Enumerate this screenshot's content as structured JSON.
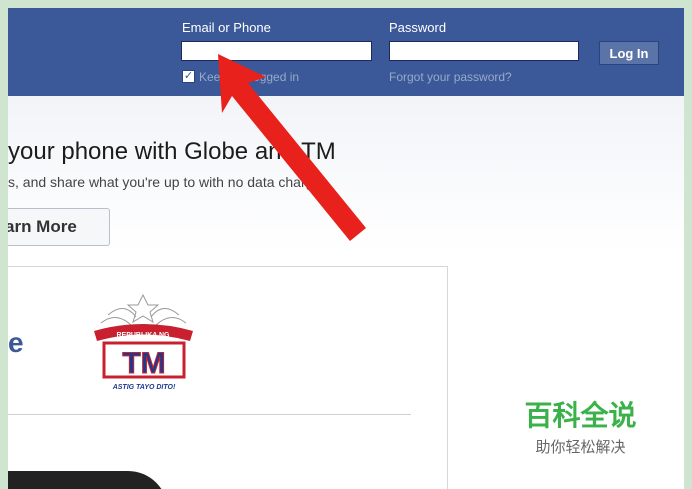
{
  "header": {
    "email_label": "Email or Phone",
    "password_label": "Password",
    "login_button": "Log In",
    "keep_logged_in": "Keep me logged in",
    "forgot_password": "Forgot your password?",
    "email_value": "",
    "password_value": ""
  },
  "promo": {
    "headline": "your phone with Globe and TM",
    "subtext": "s, and share what you're up to with no data charges.",
    "learn_more": "arn More"
  },
  "card": {
    "partial_letter": "e",
    "logo_banner": "REPUBLIKA NG",
    "logo_text": "TM",
    "logo_tagline": "ASTIG TAYO DITO!"
  },
  "watermark": {
    "title": "百科全说",
    "subtitle": "助你轻松解决"
  },
  "colors": {
    "facebook_blue": "#3b5998",
    "arrow_red": "#e8211c",
    "watermark_green": "#3bb14a"
  },
  "icons": {
    "checkbox": "checkmark-icon",
    "arrow": "pointer-arrow-icon"
  }
}
